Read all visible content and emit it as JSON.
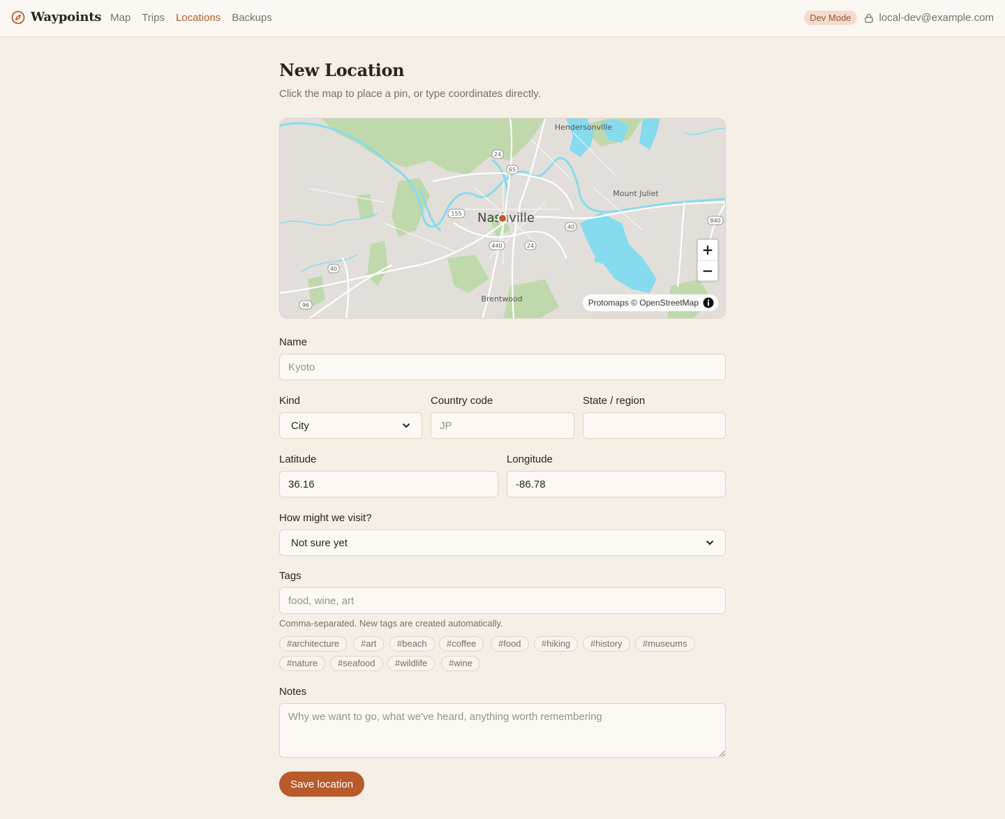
{
  "app": {
    "name": "Waypoints",
    "nav": [
      {
        "label": "Map",
        "active": false
      },
      {
        "label": "Trips",
        "active": false
      },
      {
        "label": "Locations",
        "active": true
      },
      {
        "label": "Backups",
        "active": false
      }
    ],
    "badge": "Dev Mode",
    "user_email": "local-dev@example.com"
  },
  "page": {
    "title": "New Location",
    "subtitle": "Click the map to place a pin, or type coordinates directly."
  },
  "map": {
    "labels": {
      "main_city": "Nashville",
      "hendersonville": "Hendersonville",
      "mount_juliet": "Mount Juliet",
      "brentwood": "Brentwood"
    },
    "shields": [
      "24",
      "65",
      "155",
      "40",
      "24",
      "440",
      "840",
      "40",
      "96"
    ],
    "zoom_in": "+",
    "zoom_out": "−",
    "attribution": "Protomaps © OpenStreetMap"
  },
  "form": {
    "name": {
      "label": "Name",
      "placeholder": "Kyoto",
      "value": ""
    },
    "kind": {
      "label": "Kind",
      "value": "City"
    },
    "country_code": {
      "label": "Country code",
      "placeholder": "JP",
      "value": ""
    },
    "state": {
      "label": "State / region",
      "placeholder": "",
      "value": ""
    },
    "latitude": {
      "label": "Latitude",
      "value": "36.16"
    },
    "longitude": {
      "label": "Longitude",
      "value": "-86.78"
    },
    "visit": {
      "label": "How might we visit?",
      "value": "Not sure yet"
    },
    "tags": {
      "label": "Tags",
      "placeholder": "food, wine, art",
      "hint": "Comma-separated. New tags are created automatically.",
      "suggestions": [
        "#architecture",
        "#art",
        "#beach",
        "#coffee",
        "#food",
        "#hiking",
        "#history",
        "#museums",
        "#nature",
        "#seafood",
        "#wildlife",
        "#wine"
      ]
    },
    "notes": {
      "label": "Notes",
      "placeholder": "Why we want to go, what we've heard, anything worth remembering"
    },
    "save_label": "Save location"
  },
  "colors": {
    "accent": "#b85a2a",
    "background": "#f5efe6",
    "water": "#86dbee",
    "park": "#b9d8a4"
  }
}
